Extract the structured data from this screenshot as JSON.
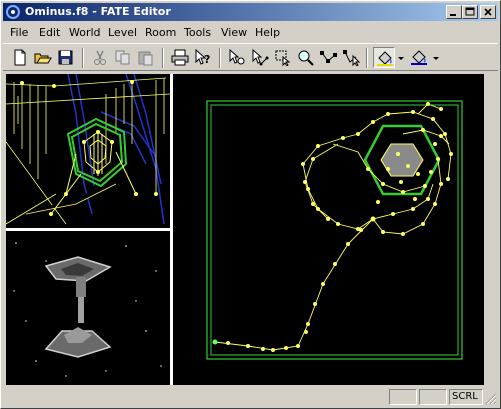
{
  "window": {
    "title": "Ominus.f8 - FATE Editor"
  },
  "menu": [
    {
      "label": "File"
    },
    {
      "label": "Edit"
    },
    {
      "label": "World"
    },
    {
      "label": "Level"
    },
    {
      "label": "Room"
    },
    {
      "label": "Tools"
    },
    {
      "label": "View"
    },
    {
      "label": "Help"
    }
  ],
  "toolbar": {
    "icons": [
      "new-file-icon",
      "open-folder-icon",
      "save-disk-icon",
      "cut-icon",
      "copy-icon",
      "paste-icon",
      "print-icon",
      "help-cursor-icon",
      "select-vertex-icon",
      "select-path-icon",
      "select-rect-icon",
      "zoom-icon",
      "edit-path-icon",
      "move-node-icon",
      "paint-bucket-icon",
      "dropdown-arrow-icon",
      "fill-color-icon",
      "dropdown-arrow-icon"
    ]
  },
  "statusbar": {
    "panels": [
      "",
      "",
      "SCRL"
    ]
  },
  "colors": {
    "title_start": "#0a246a",
    "title_end": "#a6caf0",
    "chrome": "#d4d0c8",
    "viewport_bg": "#000000",
    "path_yellow": "#ffff66",
    "room_green": "#33cc33",
    "wire_blue": "#2233cc"
  }
}
